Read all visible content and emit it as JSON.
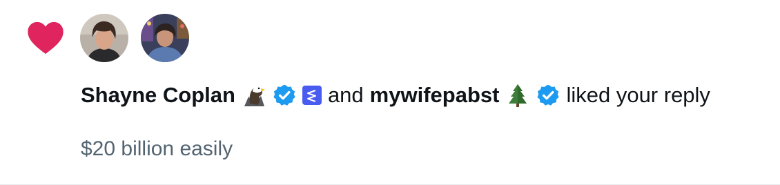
{
  "notification": {
    "type_icon": "heart-icon",
    "accent_color": "#f91880",
    "verified_color": "#1d9bf0",
    "affiliate_color": "#4a5cf0",
    "users": [
      {
        "name": "Shayne Coplan",
        "emoji": "eagle",
        "verified": true,
        "affiliate_badge": true
      },
      {
        "name": "mywifepabst",
        "emoji": "evergreen-tree",
        "verified": true
      }
    ],
    "connector": "and",
    "action_text": "liked your reply",
    "reply_text": "$20 billion easily"
  }
}
